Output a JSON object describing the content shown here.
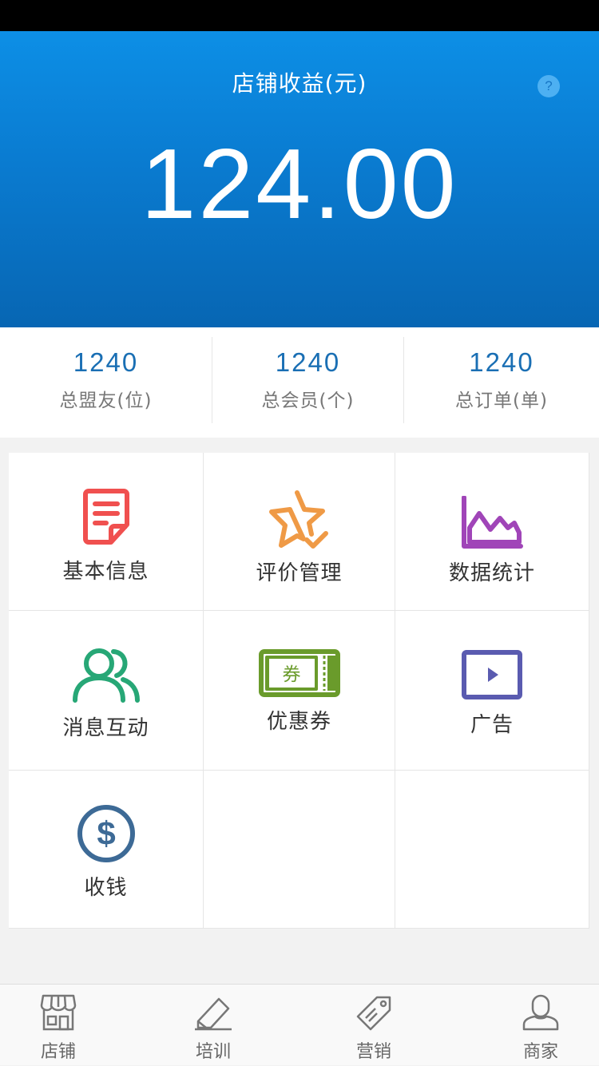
{
  "hero": {
    "title": "店铺收益(元)",
    "help": "?",
    "amount": "124.00"
  },
  "stats": [
    {
      "value": "1240",
      "label": "总盟友(位)"
    },
    {
      "value": "1240",
      "label": "总会员(个)"
    },
    {
      "value": "1240",
      "label": "总订单(单)"
    }
  ],
  "menu": [
    {
      "label": "基本信息",
      "icon": "document-icon",
      "color": "#f0504f"
    },
    {
      "label": "评价管理",
      "icon": "star-check-icon",
      "color": "#ef9a46"
    },
    {
      "label": "数据统计",
      "icon": "area-chart-icon",
      "color": "#a045b8"
    },
    {
      "label": "消息互动",
      "icon": "users-icon",
      "color": "#27a776"
    },
    {
      "label": "优惠券",
      "icon": "coupon-icon",
      "color": "#6a9b2b",
      "badge": "券"
    },
    {
      "label": "广告",
      "icon": "video-icon",
      "color": "#5a5bb0"
    },
    {
      "label": "收钱",
      "icon": "dollar-icon",
      "color": "#3d6a96"
    }
  ],
  "tabs": [
    {
      "label": "店铺",
      "icon": "store-icon"
    },
    {
      "label": "培训",
      "icon": "pen-icon"
    },
    {
      "label": "营销",
      "icon": "tag-icon"
    },
    {
      "label": "商家",
      "icon": "user-icon"
    }
  ]
}
